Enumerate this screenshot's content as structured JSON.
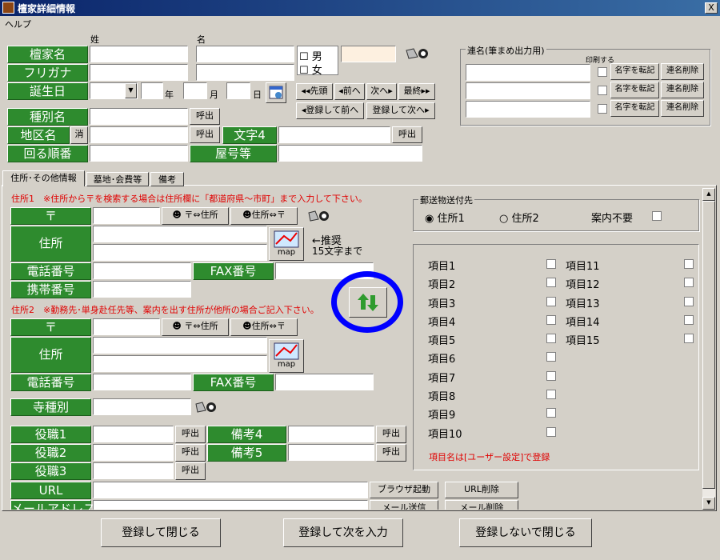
{
  "window": {
    "title": "檀家詳細情報",
    "close": "X"
  },
  "menu": {
    "help": "ヘルプ"
  },
  "top": {
    "sei": "姓",
    "mei": "名",
    "danka_name": "檀家名",
    "furigana": "フリガナ",
    "birthday": "誕生日",
    "year": "年",
    "month": "月",
    "day": "日",
    "male": "男",
    "female": "女",
    "shubetsu": "種別名",
    "chiku": "地区名",
    "keshi": "消",
    "yobidashi": "呼出",
    "moji4": "文字4",
    "junban": "回る順番",
    "yago": "屋号等"
  },
  "nav": {
    "first": "先頭",
    "prev": "前へ",
    "next": "次へ",
    "last": "最終",
    "save_prev": "登録して前へ",
    "save_next": "登録して次へ"
  },
  "renmei": {
    "title": "連名(筆まめ出力用)",
    "print": "印刷する",
    "copy": "名字を転記",
    "delete": "連名削除"
  },
  "tabs": [
    "住所･その他情報",
    "墓地･会費等",
    "備考"
  ],
  "addr1": {
    "heading": "住所1",
    "note": "※住所から〒を検索する場合は住所欄に「都道府県～市町」まで入力して下さい。",
    "zip": "〒",
    "zip_to_addr": "〒⇔住所",
    "addr_to_zip": "住所⇔〒",
    "address": "住所",
    "map": "map",
    "hint1": "←推奨",
    "hint2": "15文字まで",
    "tel": "電話番号",
    "fax": "FAX番号",
    "mobile": "携帯番号"
  },
  "addr2": {
    "heading": "住所2",
    "note": "※勤務先･単身赴任先等、案内を出す住所が他所の場合ご記入下さい。",
    "zip": "〒",
    "zip_to_addr": "〒⇔住所",
    "addr_to_zip": "住所⇔〒",
    "address": "住所",
    "map": "map",
    "tel": "電話番号",
    "fax": "FAX番号"
  },
  "misc": {
    "jishu": "寺種別",
    "yaku1": "役職1",
    "yaku2": "役職2",
    "yaku3": "役職3",
    "biko4": "備考4",
    "biko5": "備考5",
    "url": "URL",
    "mail": "メールアドレス",
    "browser": "ブラウザ起動",
    "url_del": "URL削除",
    "mail_send": "メール送信",
    "mail_del": "メール削除",
    "yobidashi": "呼出"
  },
  "mailing": {
    "title": "郵送物送付先",
    "opt1": "住所1",
    "opt2": "住所2",
    "no_info": "案内不要"
  },
  "items": {
    "left": [
      "項目1",
      "項目2",
      "項目3",
      "項目4",
      "項目5",
      "項目6",
      "項目7",
      "項目8",
      "項目9",
      "項目10"
    ],
    "right": [
      "項目11",
      "項目12",
      "項目13",
      "項目14",
      "項目15"
    ],
    "note": "項目名は[ユーザー設定]で登録"
  },
  "footer": {
    "save_close": "登録して閉じる",
    "save_new": "登録して次を入力",
    "close_nosave": "登録しないで閉じる"
  },
  "colors": {
    "label_green": "#2e8b2e",
    "highlight_circle": "#0000ff",
    "title_bar": "#0a246a"
  }
}
